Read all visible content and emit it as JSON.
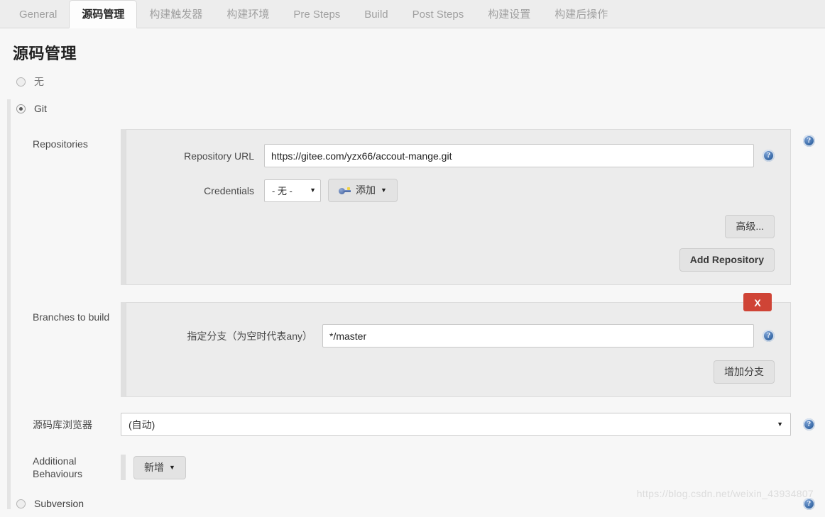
{
  "tabs": [
    {
      "label": "General",
      "active": false
    },
    {
      "label": "源码管理",
      "active": true
    },
    {
      "label": "构建触发器",
      "active": false
    },
    {
      "label": "构建环境",
      "active": false
    },
    {
      "label": "Pre Steps",
      "active": false
    },
    {
      "label": "Build",
      "active": false
    },
    {
      "label": "Post Steps",
      "active": false
    },
    {
      "label": "构建设置",
      "active": false
    },
    {
      "label": "构建后操作",
      "active": false
    }
  ],
  "page": {
    "title": "源码管理"
  },
  "scm_options": [
    {
      "label": "无",
      "selected": false
    },
    {
      "label": "Git",
      "selected": true
    },
    {
      "label": "Subversion",
      "selected": false
    }
  ],
  "repositories": {
    "section_label": "Repositories",
    "url_label": "Repository URL",
    "url_value": "https://gitee.com/yzx66/accout-mange.git",
    "credentials_label": "Credentials",
    "credentials_value": "- 无 -",
    "add_credentials_label": "添加",
    "advanced_label": "高级...",
    "add_repository_label": "Add Repository"
  },
  "branches": {
    "section_label": "Branches to build",
    "specifier_label": "指定分支（为空时代表any）",
    "specifier_value": "*/master",
    "delete_label": "X",
    "add_branch_label": "增加分支"
  },
  "repo_browser": {
    "label": "源码库浏览器",
    "value": "(自动)"
  },
  "additional_behaviours": {
    "label": "Additional Behaviours",
    "add_label": "新增"
  },
  "icons": {
    "help": "?",
    "caret": "▼"
  },
  "watermark": "https://blog.csdn.net/weixin_43934807",
  "colors": {
    "accent_blue": "#3a6ba8",
    "delete_red": "#cf4436",
    "panel_bg": "#ececec",
    "page_bg": "#f7f7f7",
    "tabbar_bg": "#ededed"
  }
}
